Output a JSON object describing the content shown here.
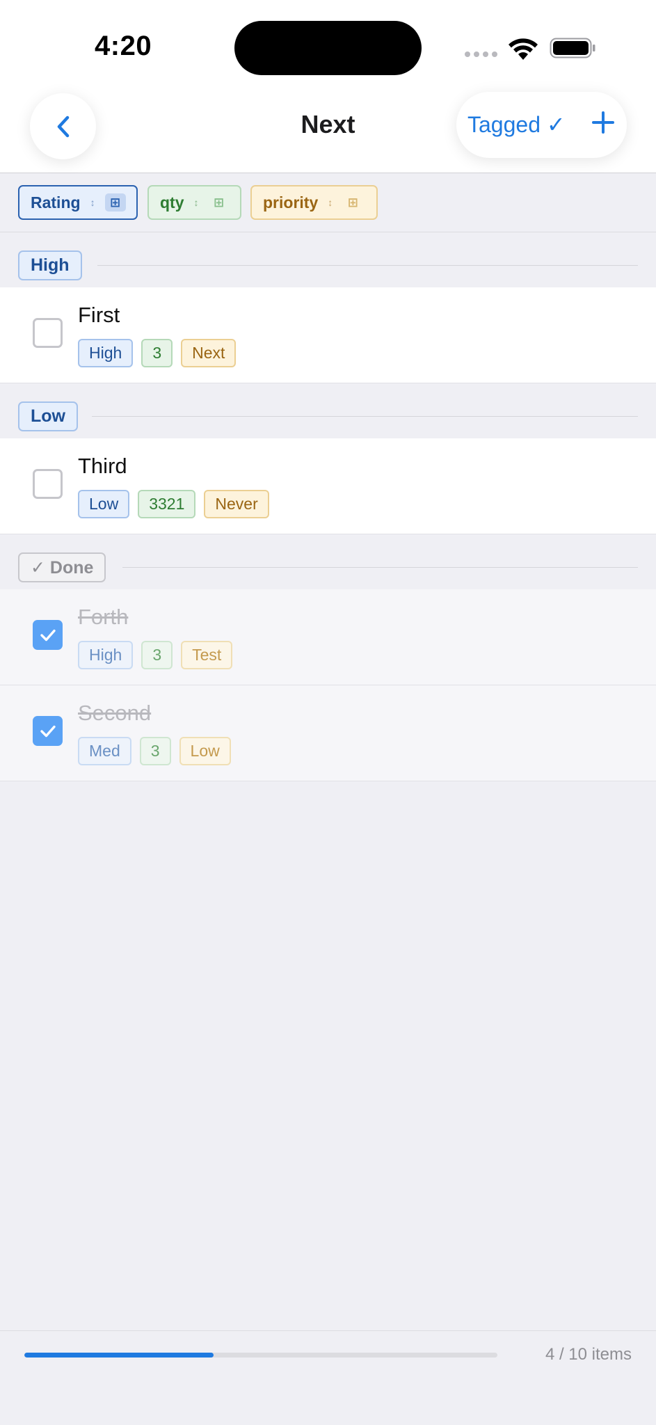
{
  "status_bar": {
    "time": "4:20"
  },
  "nav": {
    "title": "Next",
    "tagged_label": "Tagged ✓"
  },
  "filters": {
    "chips": [
      {
        "label": "Rating",
        "active": true,
        "color": "#2b62b0"
      },
      {
        "label": "qty",
        "active": false,
        "color": "#2e7d32"
      },
      {
        "label": "priority",
        "active": false,
        "color": "#9a6513"
      }
    ]
  },
  "sections": [
    {
      "label": "High",
      "items": [
        {
          "title": "First",
          "done": false,
          "tags": [
            "High",
            "3",
            "Next"
          ]
        }
      ]
    },
    {
      "label": "Low",
      "items": [
        {
          "title": "Third",
          "done": false,
          "tags": [
            "Low",
            "3321",
            "Never"
          ]
        }
      ]
    },
    {
      "label": "✓ Done",
      "items": [
        {
          "title": "Forth",
          "done": true,
          "tags": [
            "High",
            "3",
            "Test"
          ]
        },
        {
          "title": "Second",
          "done": true,
          "tags": [
            "Med",
            "3",
            "Low"
          ]
        }
      ]
    }
  ],
  "footer": {
    "progress": 0.4,
    "progress_text": "4 / 10 items"
  },
  "colors": {
    "accent": "#1f7ae0",
    "checkbox_checked": "#5aa2f5"
  }
}
